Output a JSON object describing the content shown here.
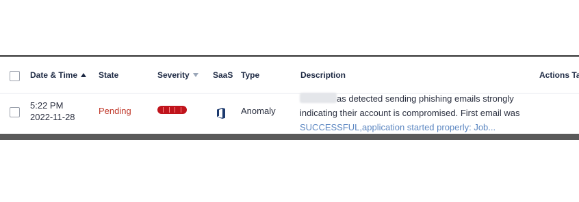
{
  "table": {
    "headers": {
      "date_time": "Date & Time",
      "state": "State",
      "severity": "Severity",
      "saas": "SaaS",
      "type": "Type",
      "description": "Description",
      "actions": "Actions Ta"
    },
    "sort": {
      "date_time": "ascending",
      "severity": "descending"
    },
    "rows": [
      {
        "time": "5:22 PM",
        "date": "2022-11-28",
        "state": "Pending",
        "state_color": "#c0392b",
        "severity_color": "#c0141c",
        "saas_icon": "office-365-icon",
        "type": "Anomaly",
        "description_line1": "as detected sending phishing emails strongly",
        "description_line2": "indicating their account is compromised. First email was",
        "description_line3": "SUCCESSFUL,application started properly: Job..."
      }
    ]
  }
}
